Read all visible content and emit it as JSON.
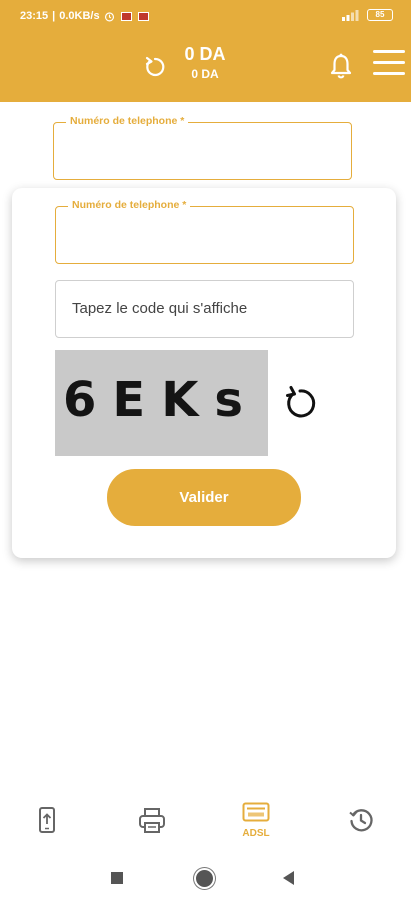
{
  "status_bar": {
    "time": "23:15",
    "speed": "0.0KB/s",
    "battery": "85"
  },
  "header": {
    "balance_main": "0 DA",
    "balance_sub": "0 DA"
  },
  "background_form": {
    "phone_label": "Numéro de telephone *",
    "phone_value": ""
  },
  "recharge_card": {
    "phone_label": "Numéro de telephone *",
    "phone_value": "",
    "code_placeholder": "Tapez le code qui s'affiche",
    "captcha_text": "6EKs",
    "submit_label": "Valider"
  },
  "bottom_nav": {
    "items": [
      {
        "icon": "mobile-recharge-icon",
        "label": ""
      },
      {
        "icon": "printer-icon",
        "label": ""
      },
      {
        "icon": "adsl-card-icon",
        "label": "ADSL"
      },
      {
        "icon": "history-icon",
        "label": ""
      }
    ],
    "active_index": 2
  },
  "colors": {
    "primary": "#e5ad3c",
    "white": "#ffffff",
    "captcha_bg": "#c9c9c9"
  }
}
